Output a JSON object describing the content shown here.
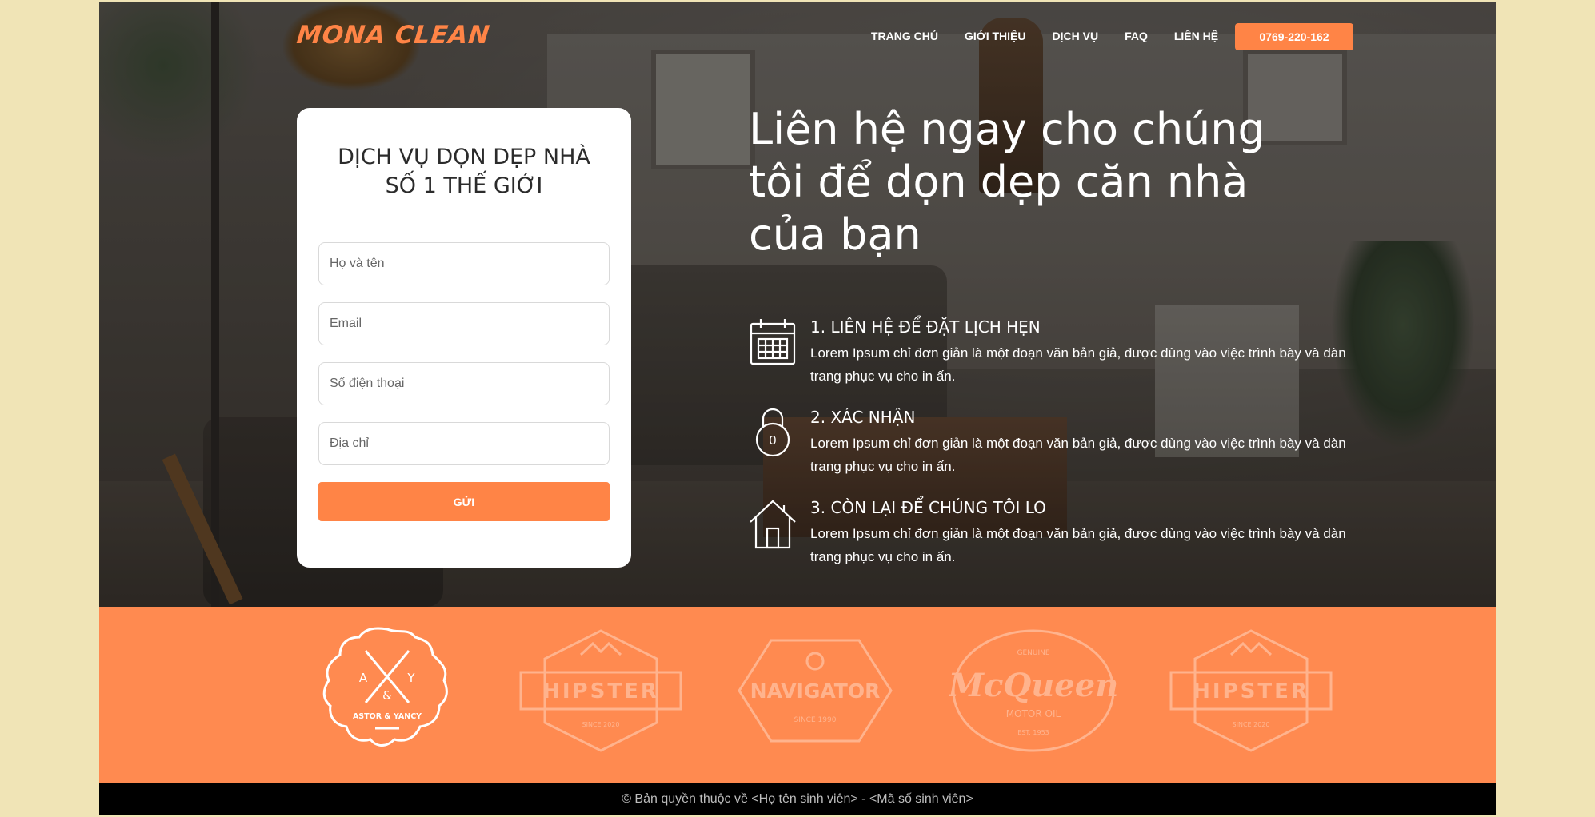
{
  "brand": {
    "logo_text": "MONA CLEAN",
    "accent": "#ff8446"
  },
  "nav": {
    "items": [
      "TRANG CHỦ",
      "GIỚI THIỆU",
      "DỊCH VỤ",
      "FAQ",
      "LIÊN HỆ"
    ],
    "phone": "0769-220-162"
  },
  "form": {
    "title": "DỊCH VỤ DỌN DẸP NHÀ\nSỐ 1 THẾ GIỚI",
    "fields": {
      "name_placeholder": "Họ và tên",
      "email_placeholder": "Email",
      "phone_placeholder": "Số điện thoại",
      "address_placeholder": "Địa chỉ"
    },
    "submit_label": "GỬI"
  },
  "hero": {
    "headline": "Liên hệ ngay cho chúng tôi để dọn dẹp căn nhà của bạn",
    "steps": [
      {
        "icon": "calendar-icon",
        "title": "1. LIÊN HỆ ĐỂ ĐẶT LỊCH HẸN",
        "desc": "Lorem Ipsum chỉ đơn giản là một đoạn văn bản giả, được dùng vào việc trình bày và dàn trang phục vụ cho in ấn."
      },
      {
        "icon": "lock-icon",
        "title": "2. XÁC NHẬN",
        "desc": "Lorem Ipsum chỉ đơn giản là một đoạn văn bản giả, được dùng vào việc trình bày và dàn trang phục vụ cho in ấn.",
        "badge": "0"
      },
      {
        "icon": "house-icon",
        "title": "3. CÒN LẠI ĐỂ CHÚNG TÔI LO",
        "desc": "Lorem Ipsum chỉ đơn giản là một đoạn văn bản giả, được dùng vào việc trình bày và dàn trang phục vụ cho in ấn."
      }
    ]
  },
  "logos": [
    {
      "name": "astor-yancy-logo",
      "lines": [
        "A",
        "Y",
        "&",
        "ASTOR & YANCY"
      ]
    },
    {
      "name": "hipster-logo",
      "lines": [
        "HIPSTER",
        "SINCE 2020"
      ]
    },
    {
      "name": "navigator-logo",
      "lines": [
        "NAVIGATOR",
        "SINCE 1990"
      ]
    },
    {
      "name": "mcqueen-logo",
      "lines": [
        "GENUINE",
        "McQueen",
        "MOTOR OIL",
        "EST. 1953"
      ]
    },
    {
      "name": "hipster-logo-2",
      "lines": [
        "HIPSTER",
        "SINCE 2020"
      ]
    }
  ],
  "footer": {
    "text": "© Bản quyền thuộc về  <Họ tên sinh viên> - <Mã số sinh viên>"
  }
}
